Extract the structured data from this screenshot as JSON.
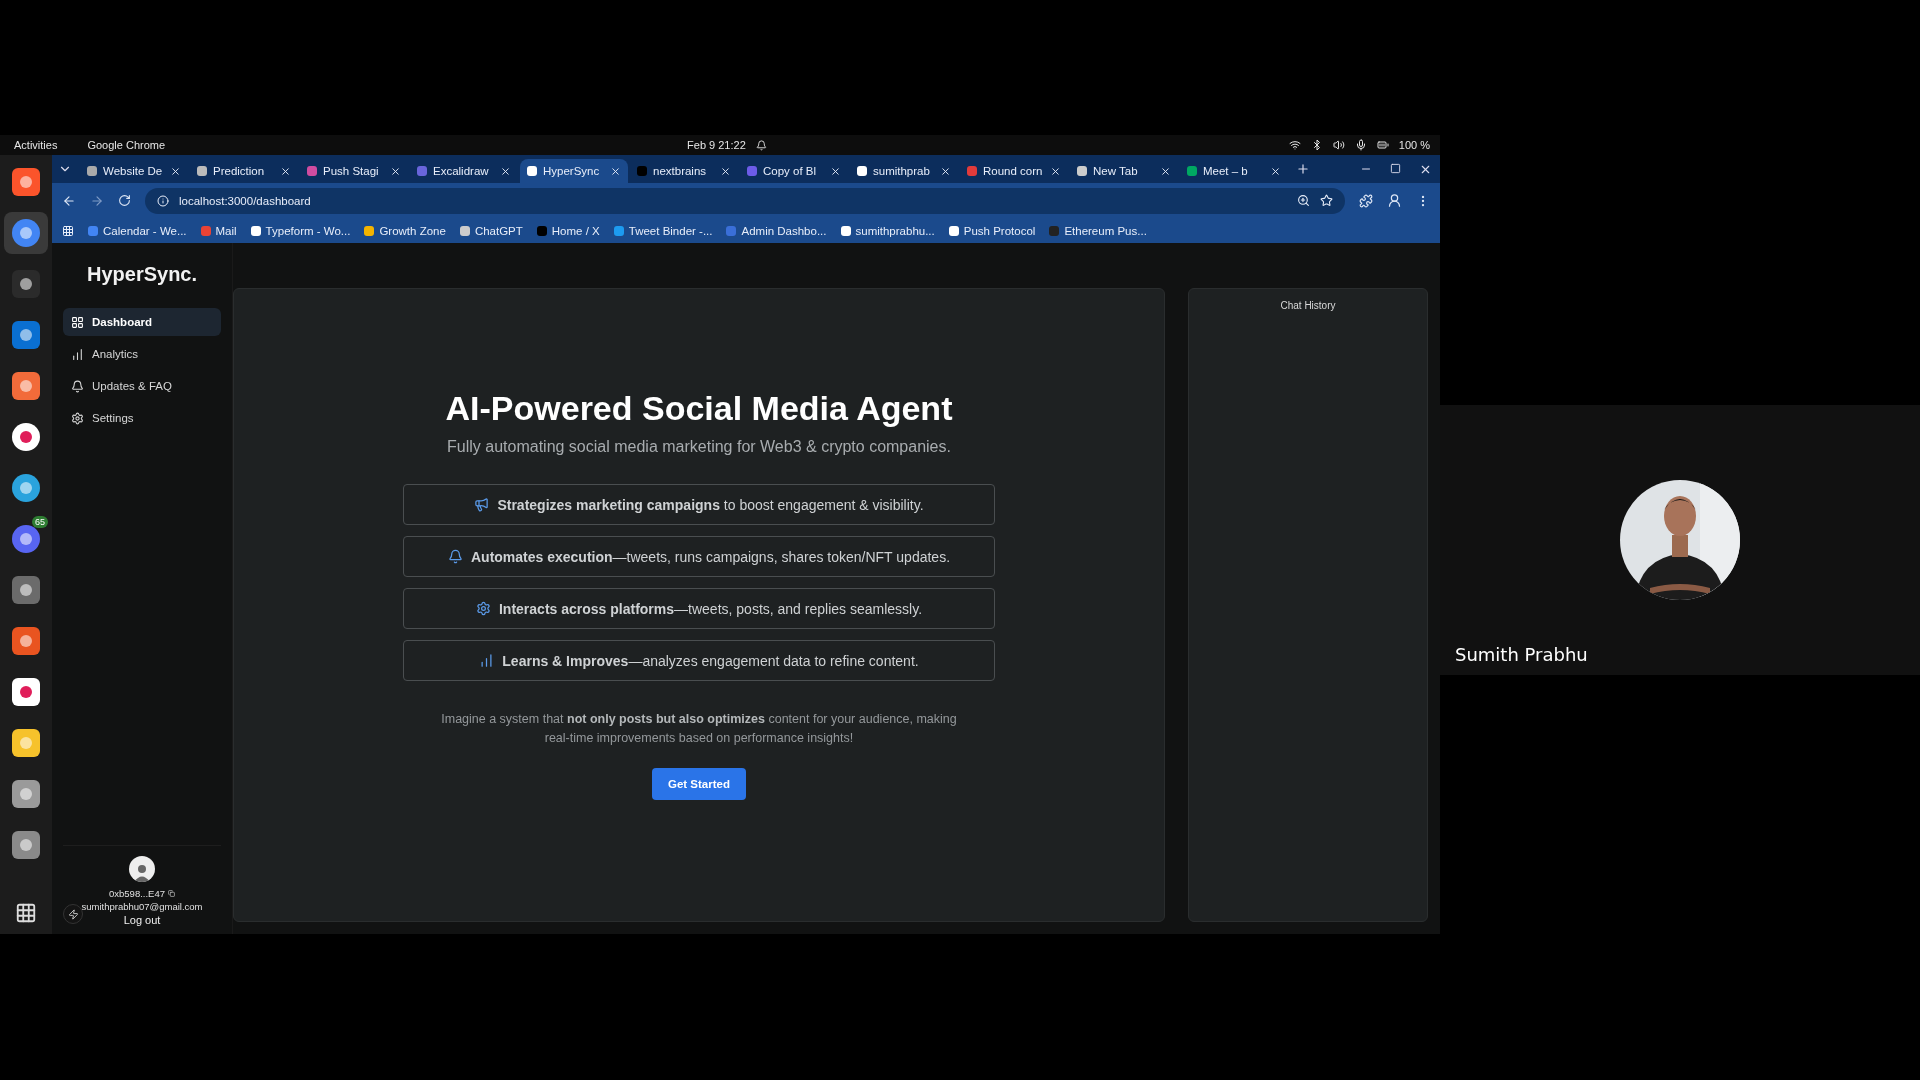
{
  "topbar": {
    "activities": "Activities",
    "app": "Google Chrome",
    "clock": "Feb 9  21:22",
    "battery": "100 %"
  },
  "dock": [
    {
      "selected": false
    },
    {
      "selected": true
    },
    {
      "selected": false
    },
    {
      "selected": false
    },
    {
      "selected": false
    },
    {
      "selected": false
    },
    {
      "selected": false
    },
    {
      "selected": false,
      "badge": "65"
    },
    {
      "selected": false
    },
    {
      "selected": false
    },
    {
      "selected": false
    },
    {
      "selected": false
    },
    {
      "selected": false
    },
    {
      "selected": false
    }
  ],
  "tabs": [
    {
      "title": "Website De",
      "selected": false
    },
    {
      "title": "Prediction",
      "selected": false
    },
    {
      "title": "Push Stagi",
      "selected": false
    },
    {
      "title": "Excalidraw",
      "selected": false
    },
    {
      "title": "HyperSync",
      "selected": true
    },
    {
      "title": "nextbrains",
      "selected": false
    },
    {
      "title": "Copy of Bl",
      "selected": false
    },
    {
      "title": "sumithprab",
      "selected": false
    },
    {
      "title": "Round corn",
      "selected": false
    },
    {
      "title": "New Tab",
      "selected": false
    },
    {
      "title": "Meet – b",
      "selected": false
    }
  ],
  "address": "localhost:3000/dashboard",
  "bookmarks": [
    "Calendar - We...",
    "Mail",
    "Typeform - Wo...",
    "Growth Zone",
    "ChatGPT",
    "Home / X",
    "Tweet Binder -...",
    "Admin Dashbo...",
    "sumithprabhu...",
    "Push Protocol",
    "Ethereum Pus..."
  ],
  "app": {
    "brand": "HyperSync.",
    "nav": [
      {
        "label": "Dashboard",
        "selected": true
      },
      {
        "label": "Analytics",
        "selected": false
      },
      {
        "label": "Updates & FAQ",
        "selected": false
      },
      {
        "label": "Settings",
        "selected": false
      }
    ],
    "user": {
      "address": "0xb598...E47",
      "email": "sumithprabhu07@gmail.com",
      "logout": "Log out"
    },
    "hero": {
      "title": "AI-Powered Social Media Agent",
      "subtitle": "Fully automating social media marketing for Web3 & crypto companies.",
      "features": [
        "**Strategizes marketing campaigns** to boost engagement & visibility.",
        "**Automates execution**—tweets, runs campaigns, shares token/NFT updates.",
        "**Interacts across platforms**—tweets, posts, and replies seamlessly.",
        "**Learns & Improves**—analyzes engagement data to refine content."
      ],
      "description": "Imagine a system that **not only posts but also optimizes** content for your audience, making real-time improvements based on performance insights!",
      "cta": "Get Started"
    },
    "chat": {
      "title": "Chat History"
    }
  },
  "video": {
    "name": "Sumith Prabhu"
  }
}
